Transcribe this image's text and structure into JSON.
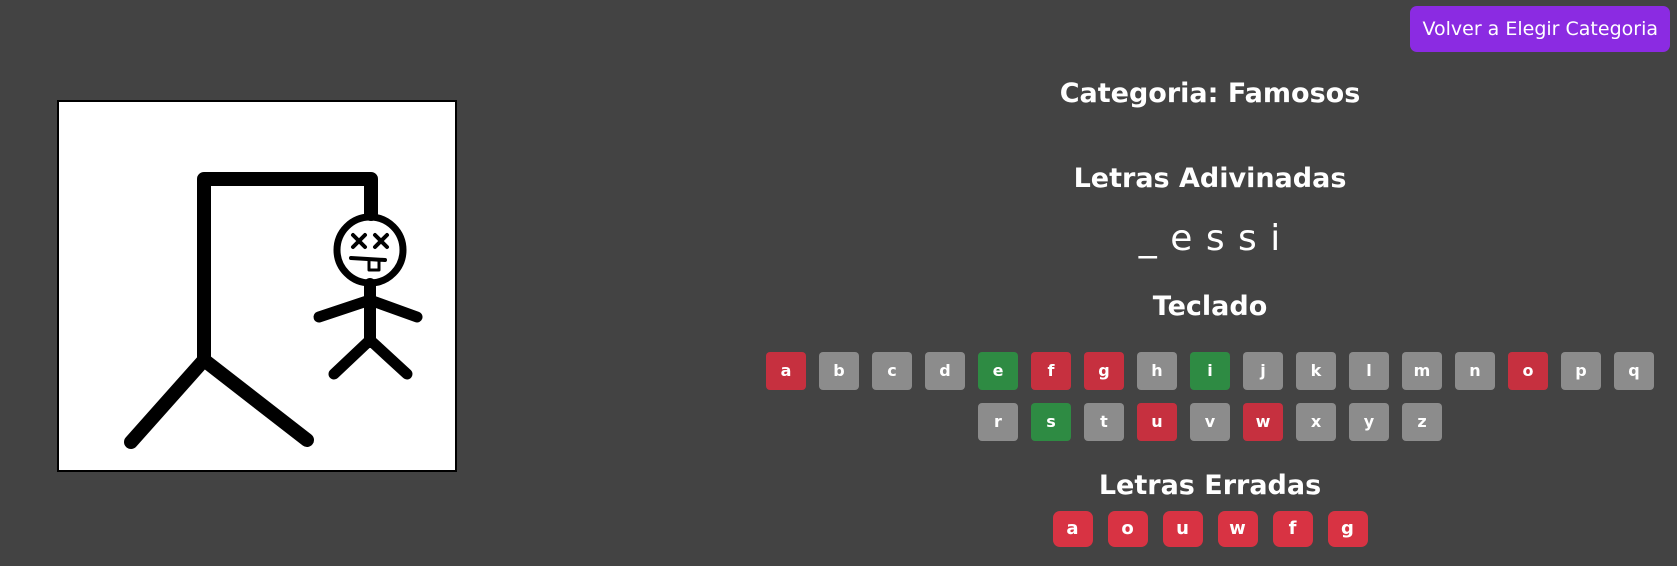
{
  "header": {
    "back_button_label": "Volver a Elegir Categoria"
  },
  "game": {
    "category_text": "Categoria: Famosos",
    "guessed_title": "Letras Adivinadas",
    "word_display": "_ e s s i",
    "keyboard_title": "Teclado",
    "wrong_title": "Letras Erradas",
    "keyboard_rows": [
      [
        {
          "letter": "a",
          "state": "wrong"
        },
        {
          "letter": "b",
          "state": "unused"
        },
        {
          "letter": "c",
          "state": "unused"
        },
        {
          "letter": "d",
          "state": "unused"
        },
        {
          "letter": "e",
          "state": "correct"
        },
        {
          "letter": "f",
          "state": "wrong"
        },
        {
          "letter": "g",
          "state": "wrong"
        },
        {
          "letter": "h",
          "state": "unused"
        },
        {
          "letter": "i",
          "state": "correct"
        },
        {
          "letter": "j",
          "state": "unused"
        },
        {
          "letter": "k",
          "state": "unused"
        },
        {
          "letter": "l",
          "state": "unused"
        },
        {
          "letter": "m",
          "state": "unused"
        },
        {
          "letter": "n",
          "state": "unused"
        },
        {
          "letter": "o",
          "state": "wrong"
        },
        {
          "letter": "p",
          "state": "unused"
        },
        {
          "letter": "q",
          "state": "unused"
        }
      ],
      [
        {
          "letter": "r",
          "state": "unused"
        },
        {
          "letter": "s",
          "state": "correct"
        },
        {
          "letter": "t",
          "state": "unused"
        },
        {
          "letter": "u",
          "state": "wrong"
        },
        {
          "letter": "v",
          "state": "unused"
        },
        {
          "letter": "w",
          "state": "wrong"
        },
        {
          "letter": "x",
          "state": "unused"
        },
        {
          "letter": "y",
          "state": "unused"
        },
        {
          "letter": "z",
          "state": "unused"
        }
      ]
    ],
    "wrong_letters": [
      "a",
      "o",
      "u",
      "w",
      "f",
      "g"
    ]
  },
  "colors": {
    "background": "#434343",
    "accent_button": "#8b2be2",
    "key_unused": "#8c8c8c",
    "key_correct": "#2e8b43",
    "key_wrong": "#c6303f",
    "wrong_badge": "#d83343"
  },
  "icons": {
    "hangman_image": "hangman-drawing-icon"
  }
}
